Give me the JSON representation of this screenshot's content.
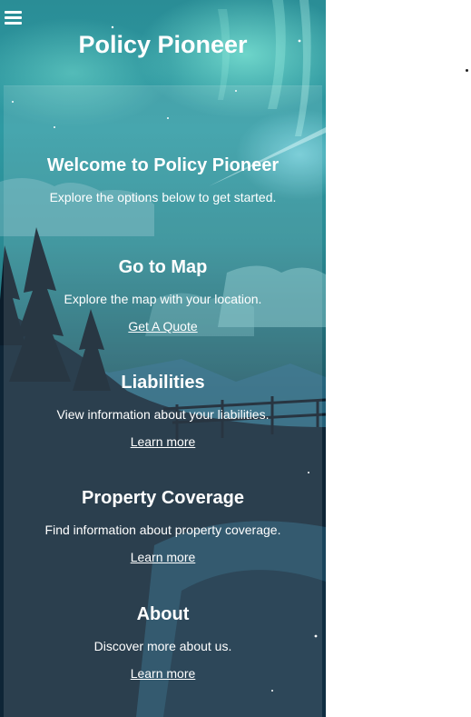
{
  "header": {
    "title": "Policy Pioneer",
    "menu_icon": "hamburger-menu-icon"
  },
  "welcome": {
    "heading": "Welcome to Policy Pioneer",
    "text": "Explore the options below to get started."
  },
  "sections": [
    {
      "heading": "Go to Map",
      "text": "Explore the map with your location.",
      "link": "Get A Quote"
    },
    {
      "heading": "Liabilities",
      "text": "View information about your liabilities.",
      "link": "Learn more"
    },
    {
      "heading": "Property Coverage",
      "text": "Find information about property coverage.",
      "link": "Learn more"
    },
    {
      "heading": "About",
      "text": "Discover more about us.",
      "link": "Learn more"
    }
  ],
  "colors": {
    "text": "#ffffff",
    "sky_teal": "#2e9aa3",
    "night_navy": "#0b1a27"
  }
}
